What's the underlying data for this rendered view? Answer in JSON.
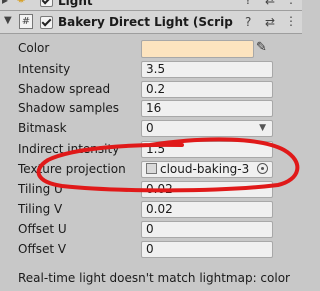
{
  "top_header": {
    "title": "Light"
  },
  "component": {
    "title": "Bakery Direct Light (Scrip"
  },
  "fields": [
    {
      "label": "Color",
      "type": "color",
      "value": "",
      "color": "#fde4bf"
    },
    {
      "label": "Intensity",
      "type": "number",
      "value": "3.5"
    },
    {
      "label": "Shadow spread",
      "type": "number",
      "value": "0.2"
    },
    {
      "label": "Shadow samples",
      "type": "number",
      "value": "16"
    },
    {
      "label": "Bitmask",
      "type": "dropdown",
      "value": "0"
    },
    {
      "label": "Indirect intensity",
      "type": "number",
      "value": "1.5"
    },
    {
      "label": "Texture projection",
      "type": "object",
      "value": "cloud-baking-3"
    },
    {
      "label": "Tiling U",
      "type": "number",
      "value": "0.02"
    },
    {
      "label": "Tiling V",
      "type": "number",
      "value": "0.02"
    },
    {
      "label": "Offset U",
      "type": "number",
      "value": "0"
    },
    {
      "label": "Offset V",
      "type": "number",
      "value": "0"
    }
  ],
  "warning": {
    "text": "Real-time light doesn't match lightmap: color"
  },
  "annotation": {
    "stroke": "#e01919"
  }
}
